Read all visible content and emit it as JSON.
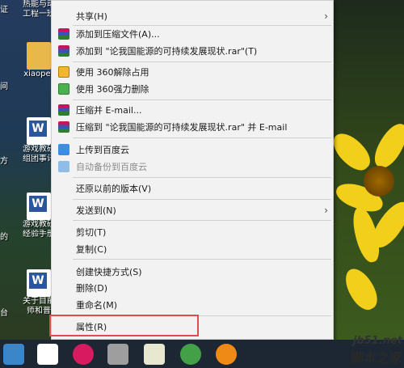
{
  "desktop": {
    "edge_text": [
      "证",
      "间",
      "方",
      "的",
      "台"
    ],
    "icons": [
      {
        "name": "热能与动力工程",
        "label1": "热能与动",
        "label2": "工程一班"
      },
      {
        "name": "xiaoper",
        "label1": "xiaoper",
        "label2": ""
      },
      {
        "name": "游戏教研组",
        "label1": "游戏教研",
        "label2": "组团事讯"
      },
      {
        "name": "游戏教研组2",
        "label1": "游戏教研",
        "label2": "经验手册"
      },
      {
        "name": "关于目前",
        "label1": "关于目前",
        "label2": "师和普"
      }
    ]
  },
  "menu": {
    "items": [
      {
        "label": "共享(H)",
        "icon": "none",
        "submenu": true,
        "disabled": false
      },
      {
        "label": "添加到压缩文件(A)...",
        "icon": "winrar-icon",
        "submenu": false,
        "disabled": false
      },
      {
        "label": "添加到 \"论我国能源的可持续发展现状.rar\"(T)",
        "icon": "winrar-icon",
        "submenu": false,
        "disabled": false
      },
      {
        "label": "使用 360解除占用",
        "icon": "360-unlock-icon",
        "submenu": false,
        "disabled": false
      },
      {
        "label": "使用 360强力删除",
        "icon": "360-delete-icon",
        "submenu": false,
        "disabled": false
      },
      {
        "label": "压缩并 E-mail...",
        "icon": "winrar-icon",
        "submenu": false,
        "disabled": false
      },
      {
        "label": "压缩到 \"论我国能源的可持续发展现状.rar\" 并 E-mail",
        "icon": "winrar-icon",
        "submenu": false,
        "disabled": false
      },
      {
        "label": "上传到百度云",
        "icon": "baidu-cloud-icon",
        "submenu": false,
        "disabled": false
      },
      {
        "label": "自动备份到百度云",
        "icon": "baidu-cloud-icon",
        "submenu": false,
        "disabled": true
      },
      {
        "label": "还原以前的版本(V)",
        "icon": "none",
        "submenu": false,
        "disabled": false
      },
      {
        "label": "发送到(N)",
        "icon": "none",
        "submenu": true,
        "disabled": false
      },
      {
        "label": "剪切(T)",
        "icon": "none",
        "submenu": false,
        "disabled": false
      },
      {
        "label": "复制(C)",
        "icon": "none",
        "submenu": false,
        "disabled": false
      },
      {
        "label": "创建快捷方式(S)",
        "icon": "none",
        "submenu": false,
        "disabled": false
      },
      {
        "label": "删除(D)",
        "icon": "none",
        "submenu": false,
        "disabled": false
      },
      {
        "label": "重命名(M)",
        "icon": "none",
        "submenu": false,
        "disabled": false
      },
      {
        "label": "属性(R)",
        "icon": "none",
        "submenu": false,
        "disabled": false
      }
    ],
    "submenu_arrow": "›"
  },
  "taskbar": {
    "apps": [
      "file-explorer-icon",
      "store-icon",
      "media-player-icon",
      "paint-icon",
      "notepad-icon",
      "refresh-app-icon",
      "wifi-app-icon"
    ]
  },
  "watermark": {
    "site": "jb51.net",
    "brand": "脚本之家"
  },
  "colors": {
    "menu_bg": "#f2f2f2",
    "highlight": "#e04b4b",
    "taskbar": "#1c2733"
  }
}
